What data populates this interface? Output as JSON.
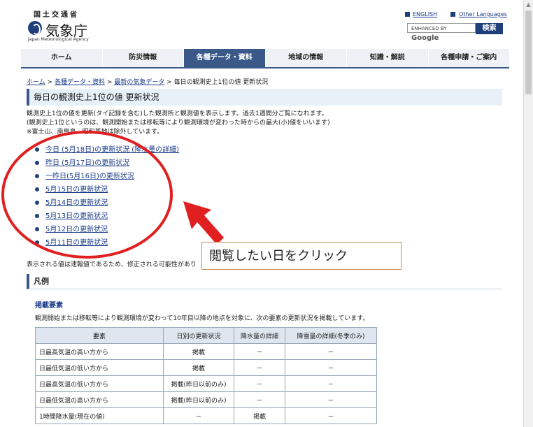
{
  "header": {
    "ministry": "国土交通省",
    "agency": "気象庁",
    "agency_en": "Japan Meteorological Agency",
    "english_link": "ENGLISH",
    "other_languages_link": "Other Languages",
    "search_placeholder": "ENHANCED BY",
    "search_brand": "Google",
    "search_button": "検索"
  },
  "nav": {
    "items": [
      "ホーム",
      "防災情報",
      "各種データ・資料",
      "地域の情報",
      "知識・解説",
      "各種申請・ご案内"
    ],
    "active_index": 2
  },
  "breadcrumb": {
    "home": "ホーム",
    "sep": ">",
    "data": "各種データ・資料",
    "latest": "最新の気象データ",
    "current": "毎日の観測史上1位の値 更新状況"
  },
  "page_title": "毎日の観測史上1位の値 更新状況",
  "intro": {
    "line1": "観測史上1位の値を更新(タイ記録を含む)した観測所と観測値を表示します。過去1週間分ご覧になれます。",
    "line2": "(観測史上1位というのは、観測開始または移転等により観測環境が変わった時からの最大(小)値をいいます)",
    "line3": "※富士山、南鳥島、昭和基地は除外しています。"
  },
  "days": [
    "今日 (5月18日)の更新状況 (降水量の詳細)",
    "昨日 (5月17日)の更新状況",
    "一昨日(5月16日)の更新状況",
    "5月15日の更新状況",
    "5月14日の更新状況",
    "5月13日の更新状況",
    "5月12日の更新状況",
    "5月11日の更新状況"
  ],
  "note": "表示される値は速報値であるため、修正される可能性があり",
  "callout": "閲覧したい日をクリック",
  "legend": {
    "title": "凡例",
    "subtitle": "掲載要素",
    "description": "観測開始または移転等により観測環境が変わって10年目以降の地点を対象に、次の要素の更新状況を掲載しています。",
    "headers": [
      "要素",
      "日別の更新状況",
      "降水量の詳細",
      "降雪量の詳細(冬季のみ)"
    ],
    "rows": [
      [
        "日最高気温の高い方から",
        "掲載",
        "－",
        "－"
      ],
      [
        "日最低気温の低い方から",
        "掲載",
        "－",
        "－"
      ],
      [
        "日最高気温の低い方から",
        "掲載(昨日以前のみ)",
        "－",
        "－"
      ],
      [
        "日最低気温の高い方から",
        "掲載(昨日以前のみ)",
        "－",
        "－"
      ],
      [
        "1時間降水量(現在の値)",
        "－",
        "掲載",
        "－"
      ]
    ]
  },
  "colors": {
    "brand": "#1f3f7a",
    "nav_active": "#3a5888",
    "annotation": "#e02020"
  }
}
